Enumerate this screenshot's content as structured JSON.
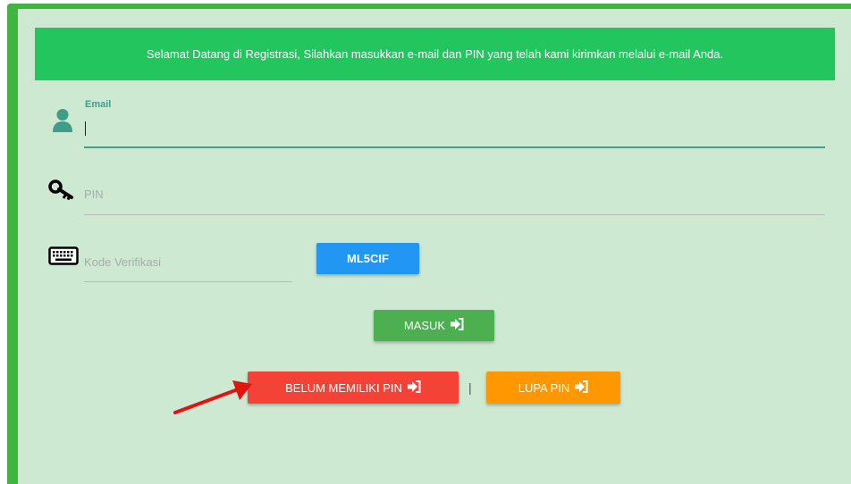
{
  "banner": {
    "text": "Selamat Datang di Registrasi, Silahkan masukkan e-mail dan PIN yang telah kami kirimkan melalui e-mail Anda."
  },
  "email": {
    "label": "Email",
    "value": ""
  },
  "pin": {
    "placeholder": "PIN"
  },
  "verification": {
    "placeholder": "Kode Verifikasi",
    "captcha_code": "ML5CIF"
  },
  "buttons": {
    "login": "MASUK",
    "no_pin": "BELUM MEMILIKI PIN",
    "separator": "|",
    "forgot_pin": "LUPA PIN"
  },
  "icons": {
    "email": "user-icon",
    "pin": "key-icon",
    "verification": "keyboard-icon",
    "button_suffix": "sign-in-icon"
  },
  "colors": {
    "page_bg": "#cde9d2",
    "frame_border": "#40b540",
    "banner_bg": "#22c55e",
    "focus_line": "#3fa091",
    "captcha_button": "#2196f3",
    "login_button": "#4caf50",
    "no_pin_button": "#f44336",
    "forgot_pin_button": "#ff9800",
    "annotation_arrow": "#e3130f"
  }
}
